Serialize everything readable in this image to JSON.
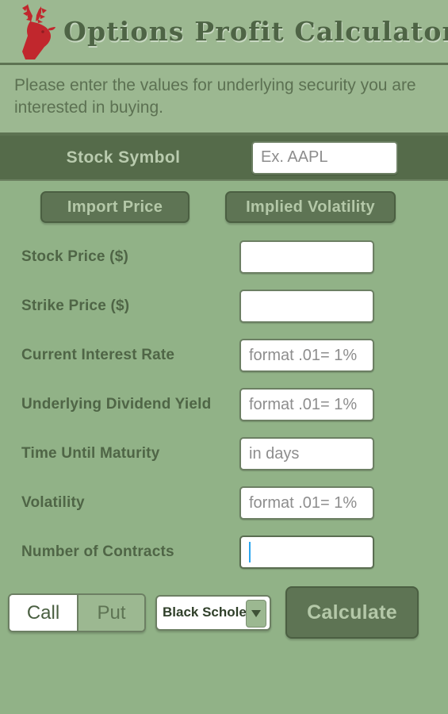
{
  "header": {
    "title": "Options Profit Calculator",
    "logo_icon": "deer-head-icon",
    "logo_color": "#c1272d",
    "accent_dark": "#556b4a",
    "background": "#91b287"
  },
  "instruction": {
    "text": "Please enter the values for underlying security you are interested in buying."
  },
  "symbol_row": {
    "label": "Stock Symbol",
    "input_placeholder": "Ex. AAPL",
    "input_value": ""
  },
  "action_buttons": {
    "import_price": "Import Price",
    "implied_volatility": "Implied Volatility"
  },
  "fields": [
    {
      "label": "Stock Price ($)",
      "placeholder": "",
      "value": "",
      "focused": false
    },
    {
      "label": "Strike Price ($)",
      "placeholder": "",
      "value": "",
      "focused": false
    },
    {
      "label": "Current Interest Rate",
      "placeholder": "format .01= 1%",
      "value": "",
      "focused": false
    },
    {
      "label": "Underlying Dividend Yield",
      "placeholder": "format .01= 1%",
      "value": "",
      "focused": false
    },
    {
      "label": "Time Until Maturity",
      "placeholder": "in days",
      "value": "",
      "focused": false
    },
    {
      "label": "Volatility",
      "placeholder": "format .01= 1%",
      "value": "",
      "focused": false
    },
    {
      "label": "Number of Contracts",
      "placeholder": "",
      "value": "",
      "focused": true
    }
  ],
  "footer": {
    "option_type": {
      "call": "Call",
      "put": "Put",
      "selected": "Call"
    },
    "model_select": {
      "selected": "Black Scholes",
      "arrow_icon": "chevron-down-icon"
    },
    "calculate": "Calculate"
  }
}
